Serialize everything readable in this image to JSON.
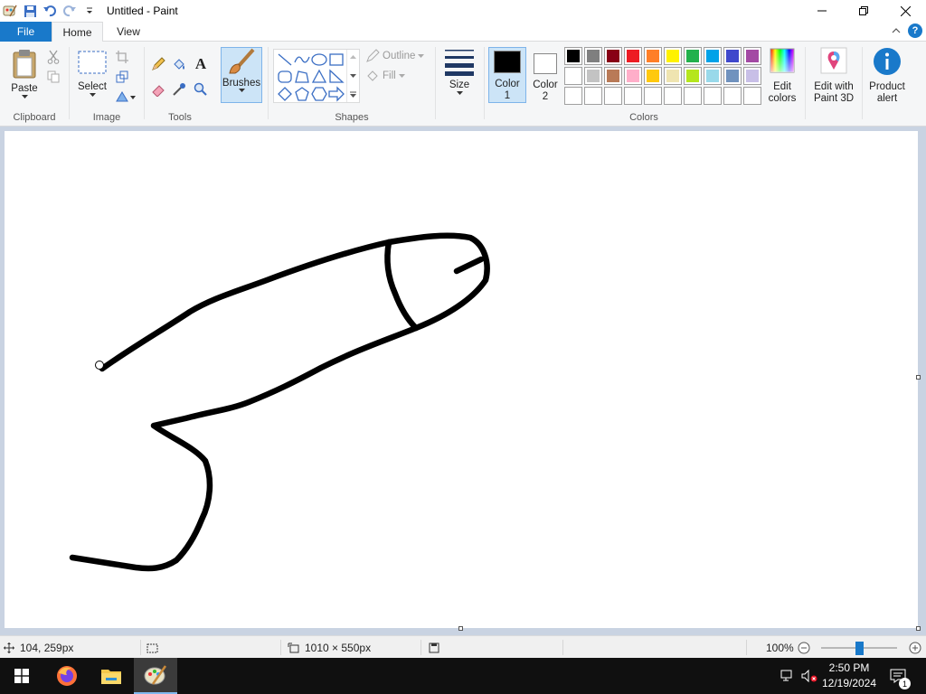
{
  "window": {
    "title": "Untitled - Paint"
  },
  "tabs": {
    "file": "File",
    "home": "Home",
    "view": "View"
  },
  "ribbon": {
    "clipboard": {
      "paste": "Paste",
      "label": "Clipboard"
    },
    "image": {
      "select": "Select",
      "label": "Image"
    },
    "tools": {
      "label": "Tools"
    },
    "brushes": "Brushes",
    "shapes": {
      "outline": "Outline",
      "fill": "Fill",
      "label": "Shapes"
    },
    "size": "Size",
    "colors": {
      "color1_line1": "Color",
      "color1_line2": "1",
      "color2_line1": "Color",
      "color2_line2": "2",
      "label": "Colors",
      "color1_value": "#000000",
      "color2_value": "#ffffff",
      "palette": [
        "#000000",
        "#7f7f7f",
        "#880015",
        "#ed1c24",
        "#ff7f27",
        "#fff200",
        "#22b14c",
        "#00a2e8",
        "#3f48cc",
        "#a349a4",
        "#ffffff",
        "#c3c3c3",
        "#b97a57",
        "#ffaec9",
        "#ffc90e",
        "#efe4b0",
        "#b5e61d",
        "#99d9ea",
        "#7092be",
        "#c8bfe7",
        "#ffffff",
        "#ffffff",
        "#ffffff",
        "#ffffff",
        "#ffffff",
        "#ffffff",
        "#ffffff",
        "#ffffff",
        "#ffffff",
        "#ffffff"
      ],
      "edit_line1": "Edit",
      "edit_line2": "colors"
    },
    "paint3d_line1": "Edit with",
    "paint3d_line2": "Paint 3D",
    "product_line1": "Product",
    "product_line2": "alert"
  },
  "status": {
    "cursor_pos": "104, 259px",
    "canvas_size": "1010 × 550px",
    "zoom": "100%",
    "zoom_level": 1.0
  },
  "taskbar": {
    "time": "2:50 PM",
    "date": "12/19/2024",
    "notification_count": "1"
  }
}
